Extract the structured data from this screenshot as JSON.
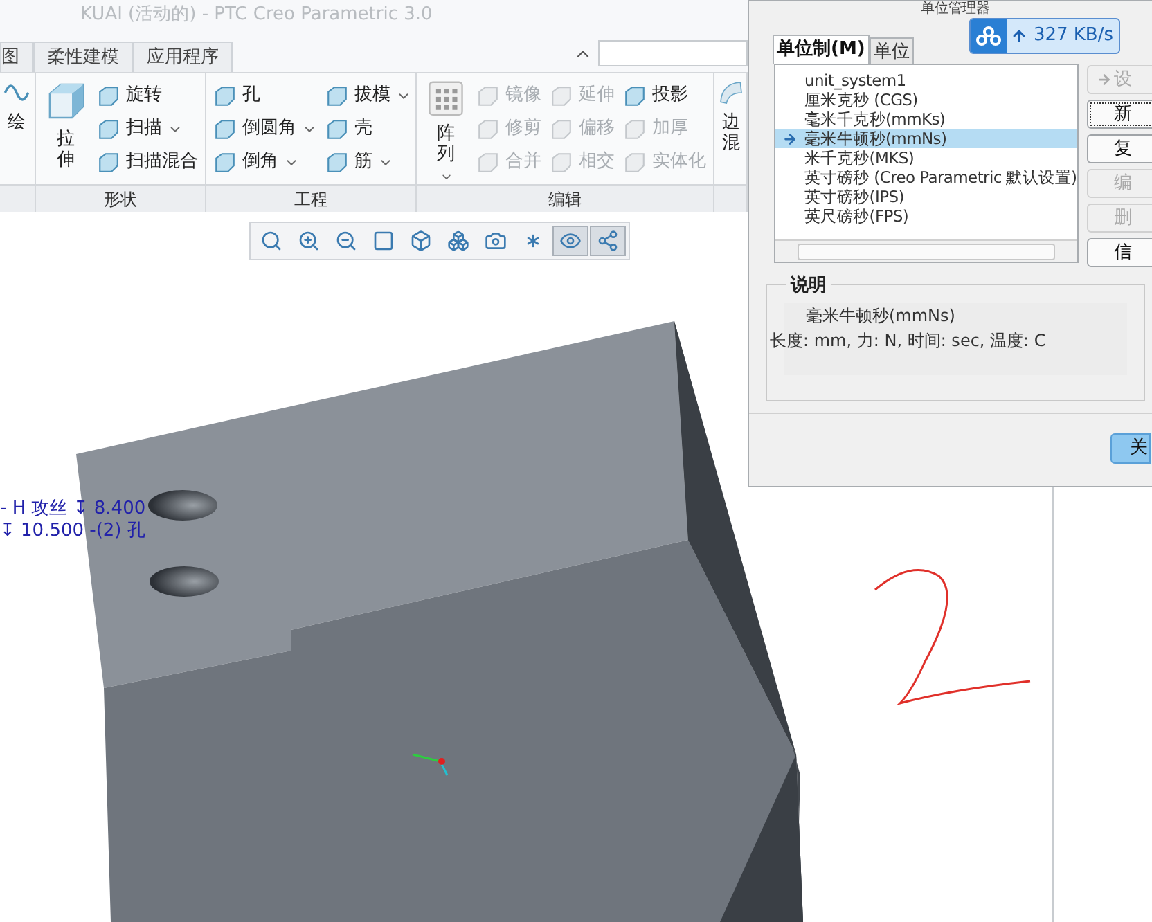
{
  "window": {
    "title": "KUAI (活动的) - PTC Creo Parametric 3.0"
  },
  "ribbon_tabs": [
    {
      "label": "图",
      "selected": false
    },
    {
      "label": "柔性建模",
      "selected": false
    },
    {
      "label": "应用程序",
      "selected": false
    }
  ],
  "ribbon_groups": [
    {
      "items": [
        {
          "kind": "large",
          "label": "绘",
          "dropdown": false,
          "disabled": false
        }
      ]
    },
    {
      "label": "形状",
      "items": [
        {
          "kind": "large",
          "label": "拉伸",
          "dropdown": false,
          "disabled": false
        },
        {
          "kind": "small",
          "label": "旋转",
          "dropdown": false,
          "disabled": false
        },
        {
          "kind": "small",
          "label": "扫描",
          "dropdown": true,
          "disabled": false
        },
        {
          "kind": "small",
          "label": "扫描混合",
          "dropdown": false,
          "disabled": false
        }
      ]
    },
    {
      "label": "工程",
      "items": [
        {
          "kind": "small",
          "label": "孔",
          "dropdown": false,
          "disabled": false
        },
        {
          "kind": "small",
          "label": "倒圆角",
          "dropdown": true,
          "disabled": false
        },
        {
          "kind": "small",
          "label": "倒角",
          "dropdown": true,
          "disabled": false
        },
        {
          "kind": "small",
          "label": "拔模",
          "dropdown": true,
          "disabled": false
        },
        {
          "kind": "small",
          "label": "壳",
          "dropdown": false,
          "disabled": false
        },
        {
          "kind": "small",
          "label": "筋",
          "dropdown": true,
          "disabled": false
        }
      ]
    },
    {
      "label": "编辑",
      "items": [
        {
          "kind": "large",
          "label": "阵列",
          "dropdown": true,
          "disabled": false
        },
        {
          "kind": "small",
          "label": "镜像",
          "dropdown": false,
          "disabled": true
        },
        {
          "kind": "small",
          "label": "修剪",
          "dropdown": false,
          "disabled": true
        },
        {
          "kind": "small",
          "label": "合并",
          "dropdown": false,
          "disabled": true
        },
        {
          "kind": "small",
          "label": "延伸",
          "dropdown": false,
          "disabled": true
        },
        {
          "kind": "small",
          "label": "偏移",
          "dropdown": false,
          "disabled": true
        },
        {
          "kind": "small",
          "label": "相交",
          "dropdown": false,
          "disabled": true
        },
        {
          "kind": "small",
          "label": "投影",
          "dropdown": false,
          "disabled": false
        },
        {
          "kind": "small",
          "label": "加厚",
          "dropdown": false,
          "disabled": true
        },
        {
          "kind": "small",
          "label": "实体化",
          "dropdown": false,
          "disabled": true
        }
      ]
    },
    {
      "items": [
        {
          "kind": "large",
          "label": "边混",
          "dropdown": false,
          "disabled": false
        }
      ]
    }
  ],
  "graphics_toolbar": [
    {
      "pressed": false
    },
    {
      "pressed": false
    },
    {
      "pressed": false
    },
    {
      "pressed": false
    },
    {
      "pressed": false
    },
    {
      "pressed": false
    },
    {
      "pressed": false
    },
    {
      "pressed": false
    },
    {
      "pressed": true
    },
    {
      "pressed": true
    }
  ],
  "model_annotation": [
    "- H 攻丝 ↧ 8.400",
    "↧ 10.500 -(2) 孔"
  ],
  "unit_manager": {
    "title": "单位管理器",
    "speed": "327 KB/s",
    "tabs": [
      {
        "label": "单位制(M)",
        "selected": true
      },
      {
        "label": "单位",
        "selected": false
      }
    ],
    "systems": [
      {
        "label": "unit_system1",
        "selected": false,
        "active": false
      },
      {
        "label": "厘米克秒 (CGS)",
        "selected": false,
        "active": false
      },
      {
        "label": "毫米千克秒(mmKs)",
        "selected": false,
        "active": false
      },
      {
        "label": "毫米牛顿秒(mmNs)",
        "selected": true,
        "active": true
      },
      {
        "label": "米千克秒(MKS)",
        "selected": false,
        "active": false
      },
      {
        "label": "英寸磅秒 (Creo Parametric 默认设置)",
        "selected": false,
        "active": false
      },
      {
        "label": "英寸磅秒(IPS)",
        "selected": false,
        "active": false
      },
      {
        "label": "英尺磅秒(FPS)",
        "selected": false,
        "active": false
      }
    ],
    "buttons": [
      {
        "label": "设",
        "kind": "arrow",
        "disabled": true
      },
      {
        "label": "新",
        "kind": "default",
        "disabled": false
      },
      {
        "label": "复",
        "kind": "plain",
        "disabled": false
      },
      {
        "label": "编",
        "kind": "plain",
        "disabled": true
      },
      {
        "label": "删",
        "kind": "plain",
        "disabled": true
      },
      {
        "label": "信",
        "kind": "plain",
        "disabled": false
      }
    ],
    "description": {
      "title": "说明",
      "lines": [
        "毫米牛顿秒(mmNs)",
        "长度: mm, 力: N, 时间: sec, 温度: C"
      ]
    },
    "close_button": "关"
  }
}
